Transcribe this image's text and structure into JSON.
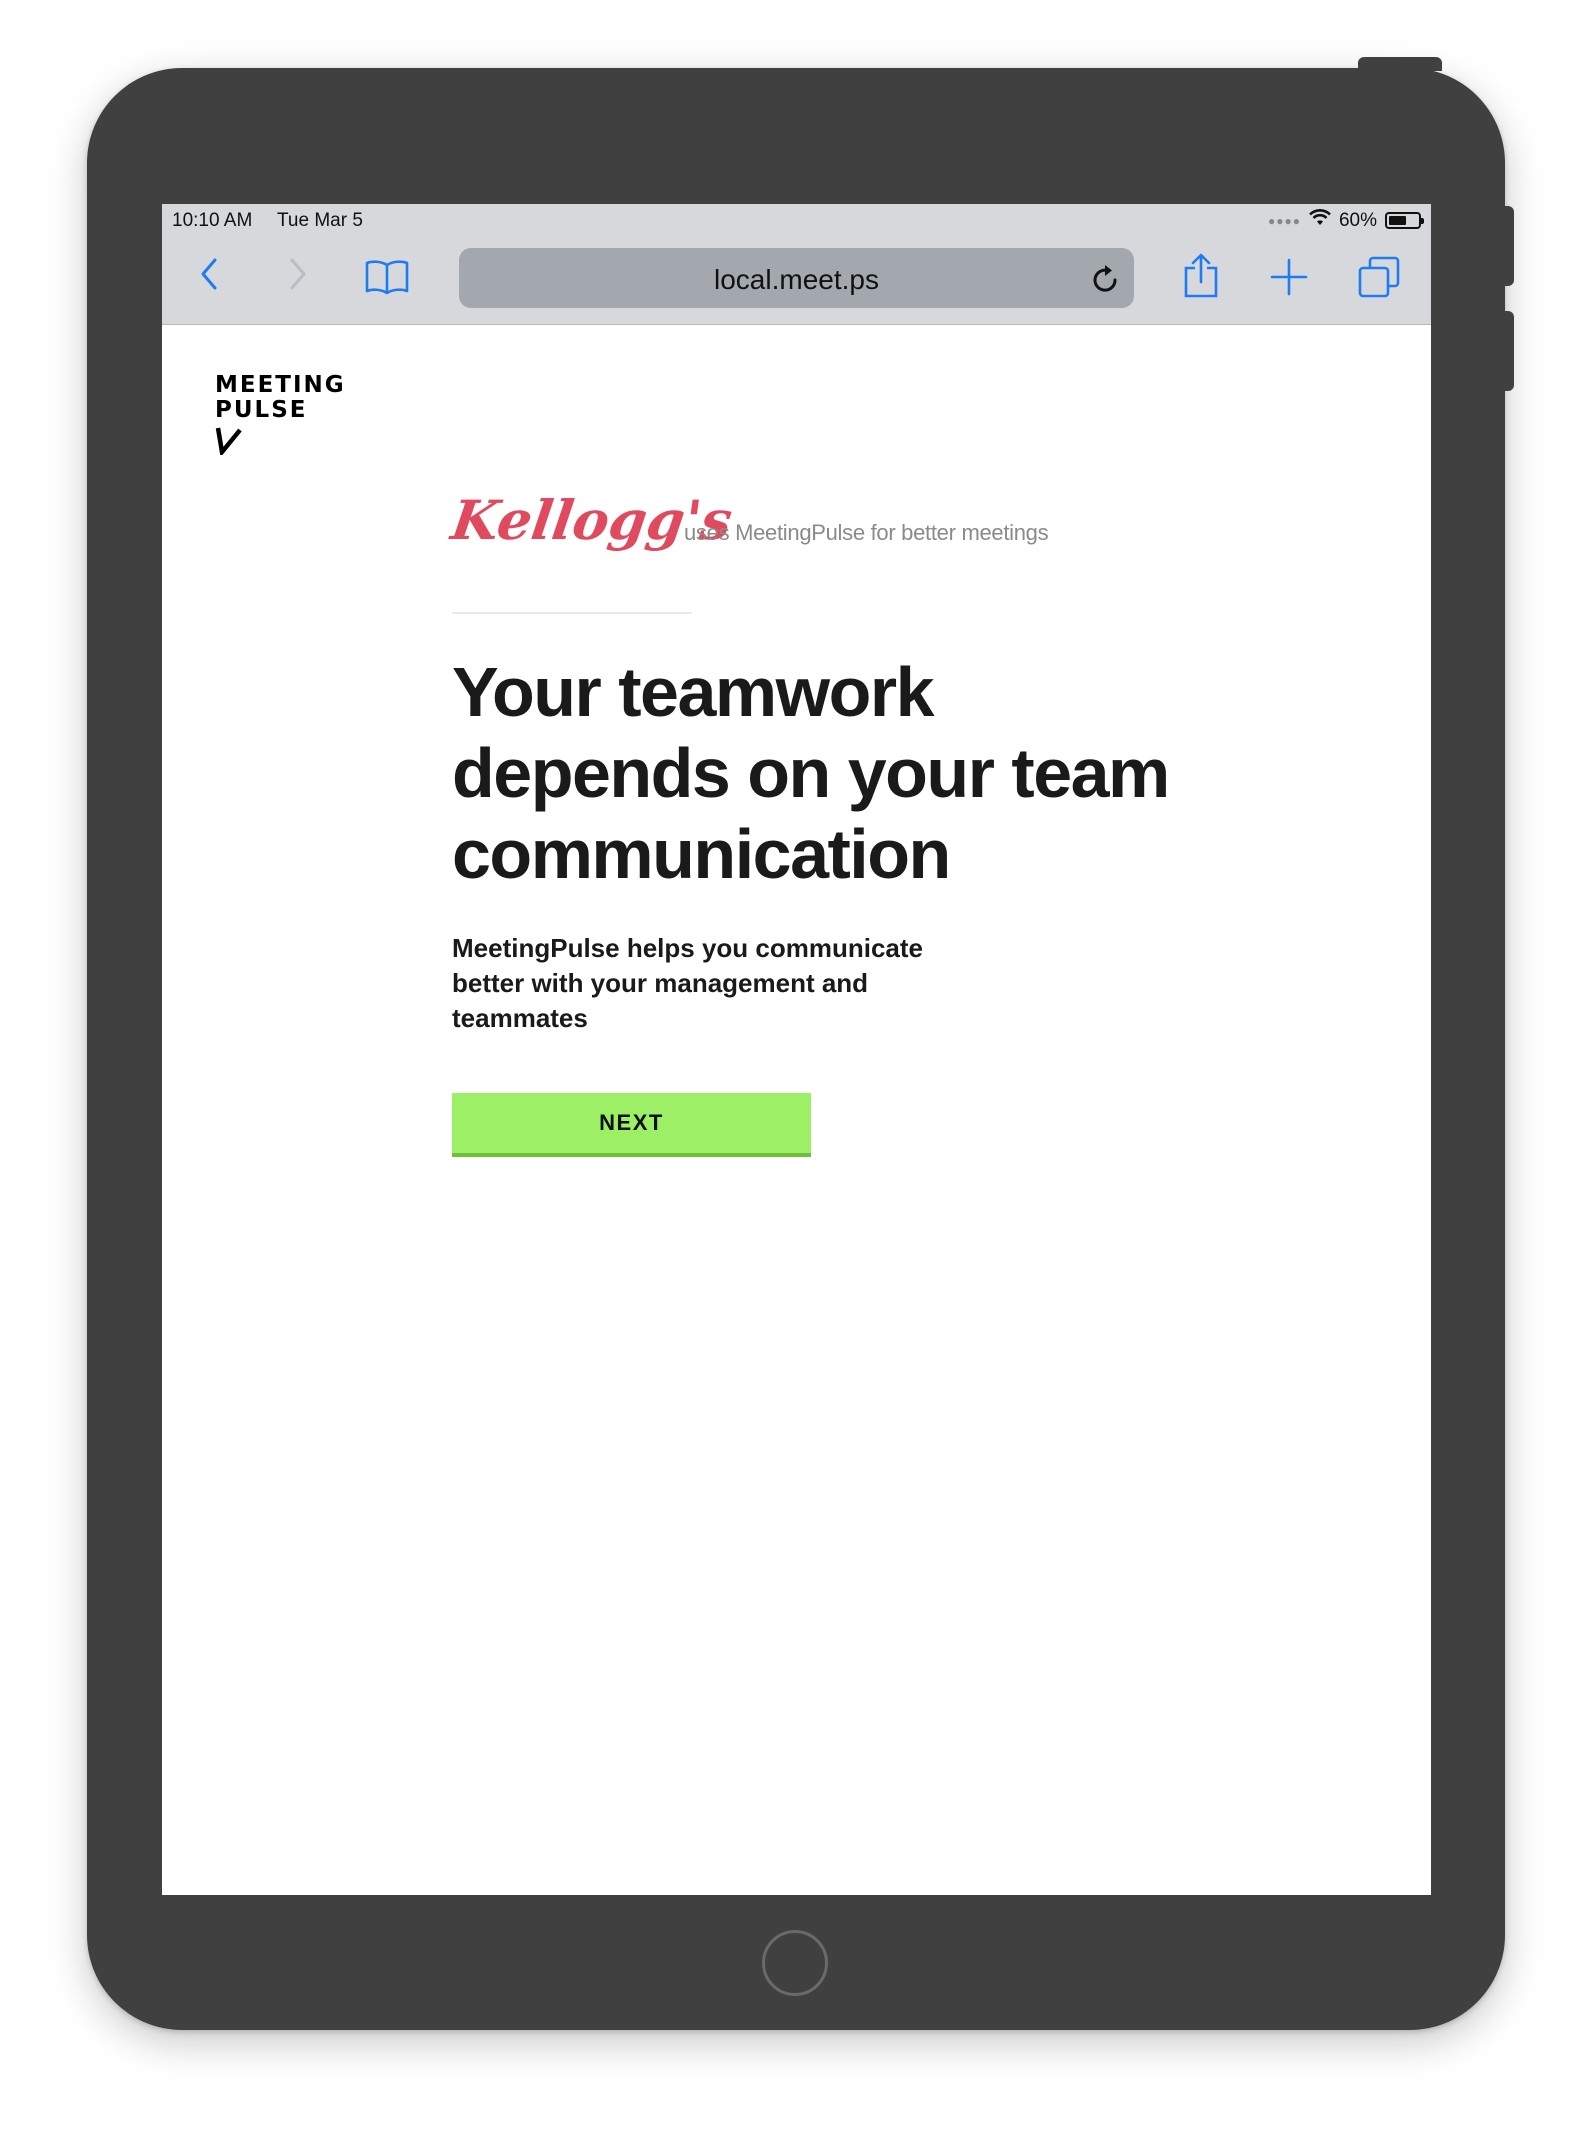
{
  "status_bar": {
    "time": "10:10 AM",
    "date": "Tue Mar 5",
    "battery_percent": "60%",
    "battery_level": 0.6
  },
  "browser": {
    "url": "local.meet.ps",
    "icons": [
      "back-chevron-icon",
      "forward-chevron-icon",
      "bookmarks-book-icon",
      "reload-icon",
      "share-icon",
      "new-tab-plus-icon",
      "tabs-icon"
    ]
  },
  "page": {
    "logo": {
      "line1": "MEETING",
      "line2": "PULSE"
    },
    "brand": {
      "name": "Kellogg's",
      "tagline": "uses MeetingPulse for better meetings",
      "color": "#e04a5f"
    },
    "headline": "Your teamwork depends on your team communication",
    "subtext": "MeetingPulse helps you communicate better with your management and teammates",
    "next_button": "NEXT",
    "accent_color": "#9def66"
  }
}
